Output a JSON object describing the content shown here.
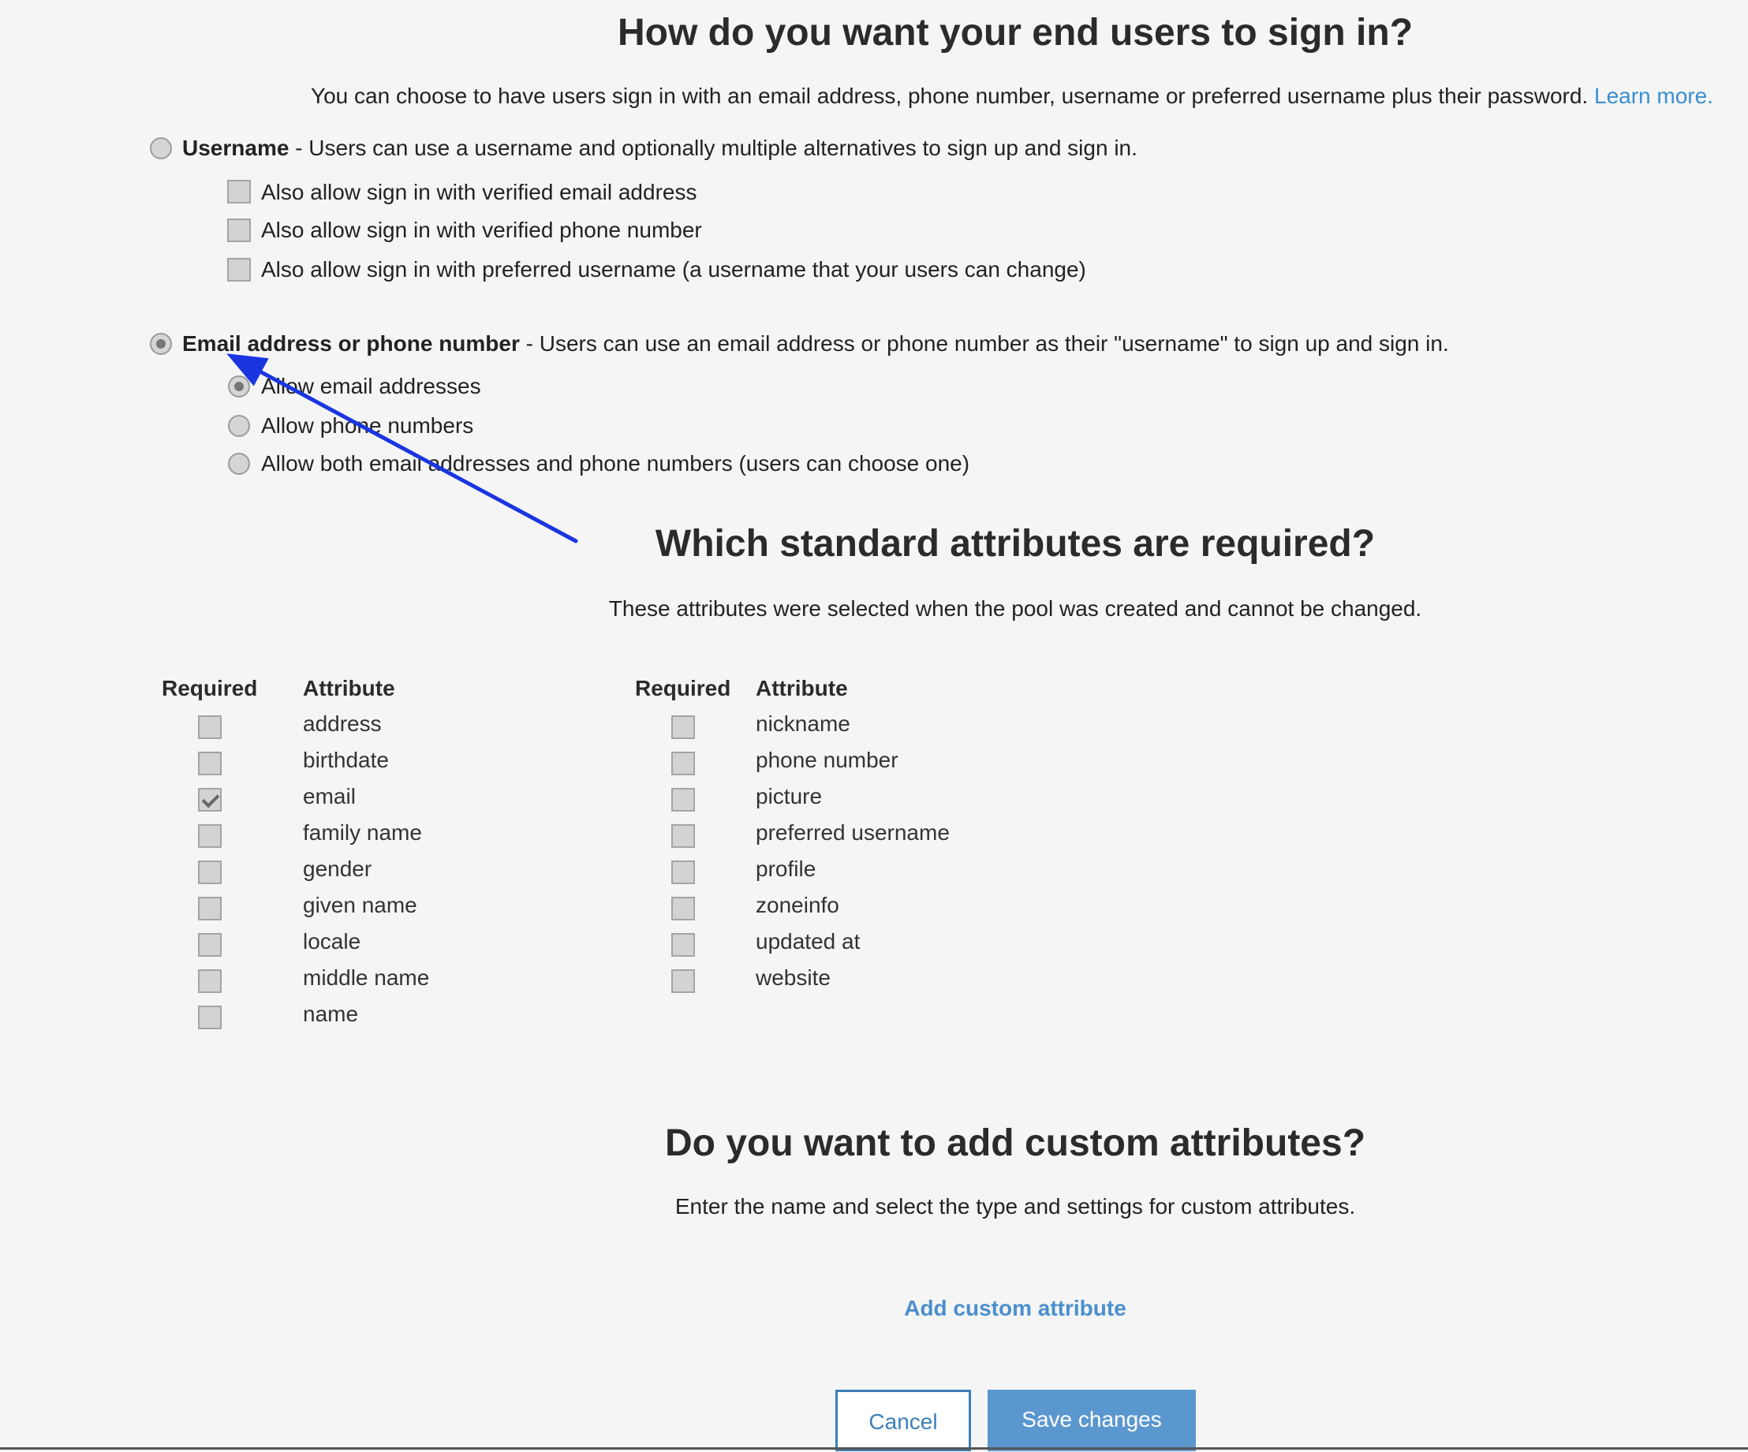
{
  "signin": {
    "title": "How do you want your end users to sign in?",
    "description": "You can choose to have users sign in with an email address, phone number, username or preferred username plus their password.",
    "learn_more": "Learn more.",
    "username_option": {
      "label": "Username",
      "description": " - Users can use a username and optionally multiple alternatives to sign up and sign in.",
      "selected": false,
      "sub_options": [
        {
          "label": "Also allow sign in with verified email address",
          "checked": false
        },
        {
          "label": "Also allow sign in with verified phone number",
          "checked": false
        },
        {
          "label": "Also allow sign in with preferred username (a username that your users can change)",
          "checked": false
        }
      ]
    },
    "email_phone_option": {
      "label": "Email address or phone number",
      "description": " - Users can use an email address or phone number as their \"username\" to sign up and sign in.",
      "selected": true,
      "sub_options": [
        {
          "label": "Allow email addresses",
          "selected": true
        },
        {
          "label": "Allow phone numbers",
          "selected": false
        },
        {
          "label": "Allow both email addresses and phone numbers (users can choose one)",
          "selected": false
        }
      ]
    }
  },
  "attributes": {
    "title": "Which standard attributes are required?",
    "description": "These attributes were selected when the pool was created and cannot be changed.",
    "col_required": "Required",
    "col_attribute": "Attribute",
    "left": [
      {
        "name": "address",
        "required": false
      },
      {
        "name": "birthdate",
        "required": false
      },
      {
        "name": "email",
        "required": true
      },
      {
        "name": "family name",
        "required": false
      },
      {
        "name": "gender",
        "required": false
      },
      {
        "name": "given name",
        "required": false
      },
      {
        "name": "locale",
        "required": false
      },
      {
        "name": "middle name",
        "required": false
      },
      {
        "name": "name",
        "required": false
      }
    ],
    "right": [
      {
        "name": "nickname",
        "required": false
      },
      {
        "name": "phone number",
        "required": false
      },
      {
        "name": "picture",
        "required": false
      },
      {
        "name": "preferred username",
        "required": false
      },
      {
        "name": "profile",
        "required": false
      },
      {
        "name": "zoneinfo",
        "required": false
      },
      {
        "name": "updated at",
        "required": false
      },
      {
        "name": "website",
        "required": false
      }
    ]
  },
  "custom": {
    "title": "Do you want to add custom attributes?",
    "description": "Enter the name and select the type and settings for custom attributes.",
    "add_link": "Add custom attribute"
  },
  "buttons": {
    "cancel": "Cancel",
    "save": "Save changes"
  },
  "annotation": {
    "arrow_color": "#1a35e0"
  },
  "colors": {
    "link": "#3b8ed1",
    "primary_button": "#5b97cf",
    "background": "#f4f5f4"
  }
}
